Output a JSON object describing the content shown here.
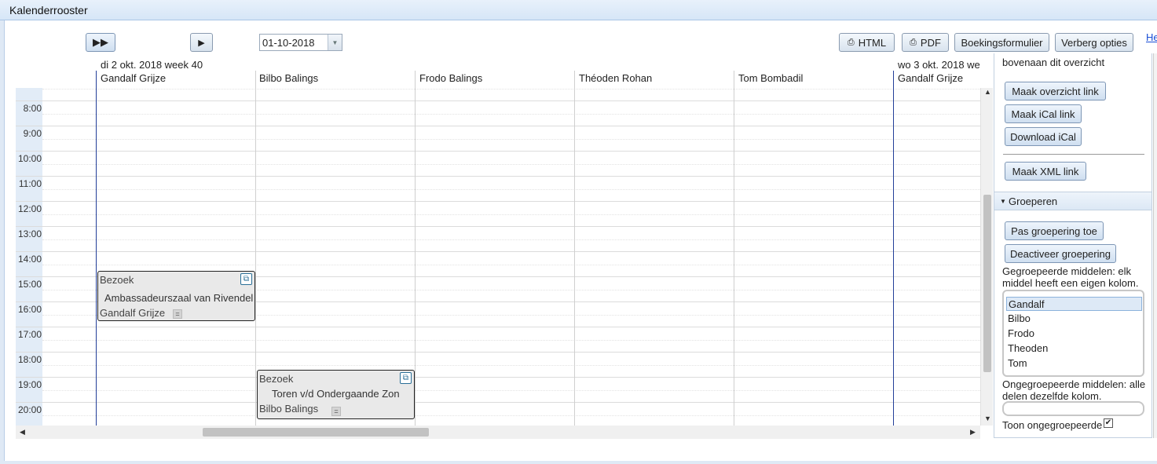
{
  "window": {
    "title": "Kalenderrooster"
  },
  "toolbar": {
    "fast_forward_label": "▶▶",
    "next_label": "▶",
    "date_value": "01-10-2018",
    "html_label": "HTML",
    "pdf_label": "PDF",
    "booking_label": "Boekingsformulier",
    "hide_options_label": "Verberg opties",
    "help_link": "He"
  },
  "calendar": {
    "day1_header": "di 2 okt. 2018 week 40",
    "day2_header": "wo 3 okt. 2018 we",
    "columns": [
      "Gandalf Grijze",
      "Bilbo Balings",
      "Frodo Balings",
      "Théoden Rohan",
      "Tom Bombadil",
      "Gandalf Grijze"
    ],
    "times": [
      "8:00",
      "9:00",
      "10:00",
      "11:00",
      "12:00",
      "13:00",
      "14:00",
      "15:00",
      "16:00",
      "17:00",
      "18:00",
      "19:00",
      "20:00"
    ],
    "events": [
      {
        "title": "Bezoek",
        "location": "Ambassadeurszaal van Rivendel",
        "resource": "Gandalf Grijze",
        "eq": "="
      },
      {
        "title": "Bezoek",
        "location": "Toren v/d Ondergaande Zon",
        "resource": "Bilbo Balings",
        "eq": "="
      }
    ]
  },
  "options": {
    "top_text": "bovenaan dit overzicht",
    "make_overview_link": "Maak overzicht link",
    "make_ical_link": "Maak iCal link",
    "download_ical": "Download iCal",
    "make_xml_link": "Maak XML link",
    "grouping_header": "Groeperen",
    "apply_grouping": "Pas groepering toe",
    "deactivate_grouping": "Deactiveer groepering",
    "grouped_text": "Gegroepeerde middelen: elk middel heeft een eigen kolom.",
    "grouped_items": [
      "Gandalf",
      "Bilbo",
      "Frodo",
      "Theoden",
      "Tom"
    ],
    "ungrouped_text": "Ongegroepeerde middelen: alle delen dezelfde kolom.",
    "show_ungrouped": "Toon ongegroepeerde"
  },
  "colors": {
    "day_line": "#233f99",
    "title_bg": "#d6e6f7",
    "event_bg": "#e9e9e9"
  }
}
